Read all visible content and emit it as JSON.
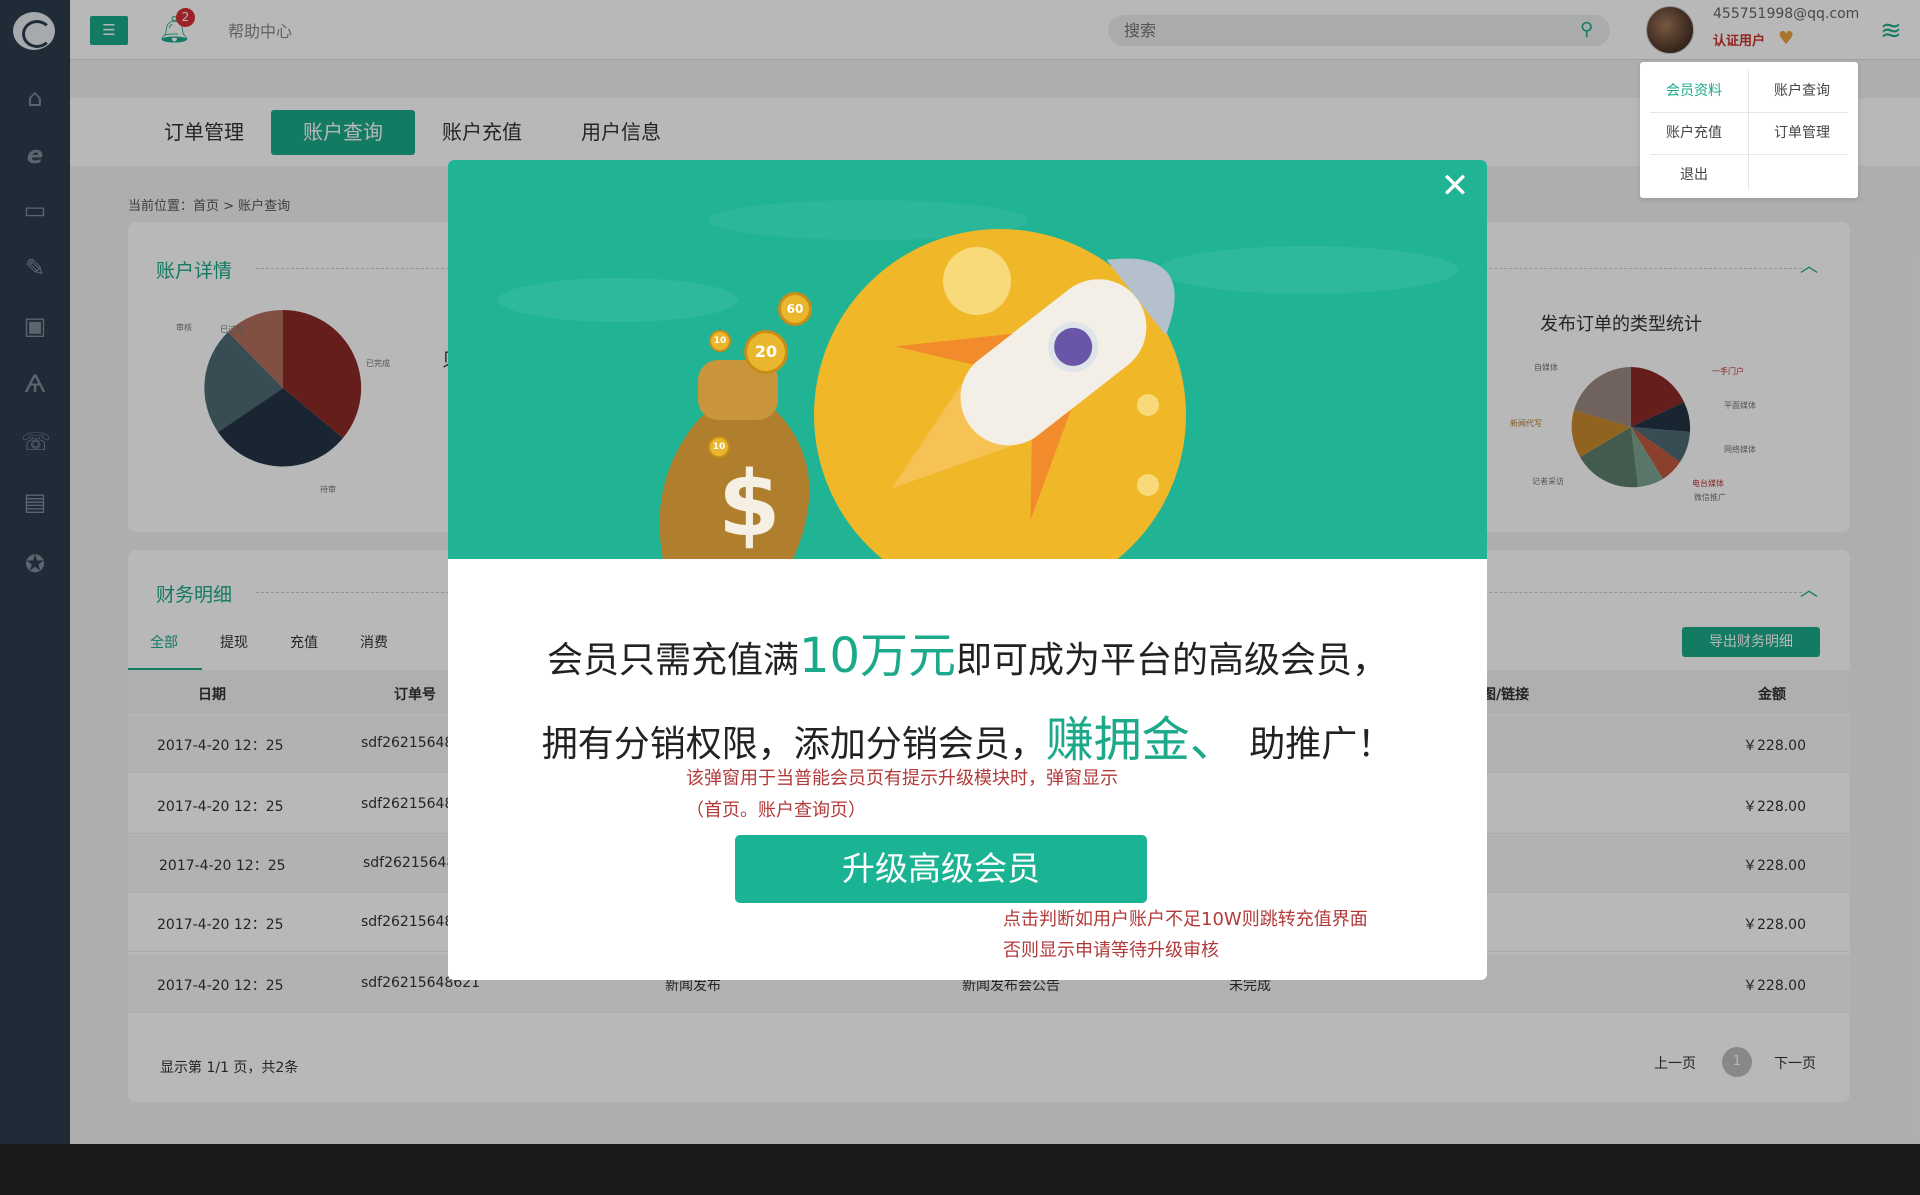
{
  "header": {
    "menu_icon": "hamburger-icon",
    "bell_count": "2",
    "help_label": "帮助中心",
    "search_placeholder": "搜索",
    "user_email": "455751998@qq.com",
    "user_status": "认证用户"
  },
  "user_menu": {
    "items": [
      "会员资料",
      "账户查询",
      "账户充值",
      "订单管理",
      "退出"
    ]
  },
  "sidebar": {
    "icons": [
      "home-icon",
      "ie-browser-icon",
      "billboard-icon",
      "edit-icon",
      "tv-icon",
      "antenna-icon",
      "phone-book-icon",
      "document-icon",
      "star-icon"
    ]
  },
  "topnav": {
    "tabs": [
      "订单管理",
      "账户查询",
      "账户充值",
      "用户信息"
    ],
    "active": "账户查询"
  },
  "breadcrumb": "当前位置：首页 > 账户查询",
  "account_card": {
    "title": "账户详情",
    "partial_text": "贝",
    "left_pie_labels": [
      "审核",
      "已完成",
      "待审",
      "已过期"
    ],
    "right_chart_title": "发布订单的类型统计",
    "right_pie_labels": [
      "一手门户",
      "平面媒体",
      "新闻代写",
      "记者采访",
      "电台媒体",
      "网络媒体",
      "自媒体",
      "微信推广"
    ]
  },
  "finance": {
    "title": "财务明细",
    "subtabs": [
      "全部",
      "提现",
      "充值",
      "消费"
    ],
    "export_label": "导出财务明细",
    "columns": {
      "date": "日期",
      "order": "订单号",
      "screenshot": "截图/链接",
      "amount": "金额"
    },
    "rows": [
      {
        "date": "2017-4-20 12：25",
        "order": "sdf26215648",
        "type": "",
        "desc": "",
        "status": "",
        "amount": "￥228.00"
      },
      {
        "date": "2017-4-20 12：25",
        "order": "sdf26215648",
        "type": "",
        "desc": "",
        "status": "",
        "amount": "￥228.00"
      },
      {
        "date": "2017-4-20 12：25",
        "order": "sdf26215648",
        "type": "",
        "desc": "",
        "status": "",
        "amount": "￥228.00"
      },
      {
        "date": "2017-4-20 12：25",
        "order": "sdf26215648",
        "type": "",
        "desc": "",
        "status": "",
        "amount": "￥228.00"
      },
      {
        "date": "2017-4-20 12：25",
        "order": "sdf26215648621",
        "type": "新闻发布",
        "desc": "新闻发布会公告",
        "status": "未完成",
        "amount": "￥228.00"
      }
    ],
    "footer_info": "显示第 1/1 页，共2条",
    "prev": "上一页",
    "page": "1",
    "next": "下一页"
  },
  "modal": {
    "close_icon": "close-icon",
    "line1_pre": "会员只需充值满",
    "line1_hl": "10万元",
    "line1_post": "即可成为平台的高级会员，",
    "line2_pre": "拥有分销权限，添加分销会员，",
    "line2_hl": "赚拥金、",
    "line2_post": " 助推广！",
    "note1_a": "该弹窗用于当普能会员页有提示升级模块时，弹窗显示",
    "note1_b": "（首页。账户查询页）",
    "button_label": "升级高级会员",
    "note2_a": "点击判断如用户账户不足10W则跳转充值界面",
    "note2_b": "否则显示申请等待升级审核",
    "coins": [
      "60",
      "10",
      "20",
      "10"
    ]
  },
  "colors": {
    "accent": "#1ba98a",
    "sidebar": "#2b3d4e",
    "note": "#b23a3a"
  }
}
